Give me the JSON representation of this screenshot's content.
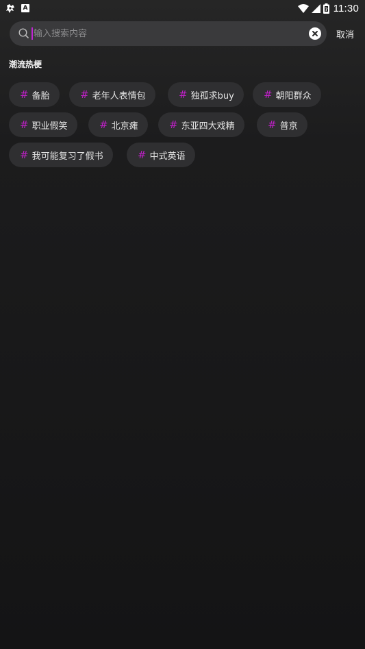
{
  "status_bar": {
    "time": "11:30",
    "a_label": "A",
    "icons": [
      "app-notification-icon",
      "a-notification-icon",
      "wifi-icon",
      "cellular-signal-icon",
      "battery-icon"
    ]
  },
  "search": {
    "placeholder": "输入搜索内容",
    "value": "",
    "cancel_label": "取消"
  },
  "section": {
    "title": "潮流热梗"
  },
  "tags": [
    {
      "hash": "#",
      "label": "备胎"
    },
    {
      "hash": "#",
      "label": "老年人表情包"
    },
    {
      "hash": "#",
      "label": "独孤求buy"
    },
    {
      "hash": "#",
      "label": "朝阳群众"
    },
    {
      "hash": "#",
      "label": "职业假笑"
    },
    {
      "hash": "#",
      "label": "北京瘫"
    },
    {
      "hash": "#",
      "label": "东亚四大戏精"
    },
    {
      "hash": "#",
      "label": "普京"
    },
    {
      "hash": "#",
      "label": "我可能复习了假书"
    },
    {
      "hash": "#",
      "label": "中式英语"
    }
  ],
  "colors": {
    "accent_hash": "#c020c8",
    "caret": "#c026d3",
    "tag_bg": "#2f2f31",
    "search_bg": "#3a3a3c"
  }
}
